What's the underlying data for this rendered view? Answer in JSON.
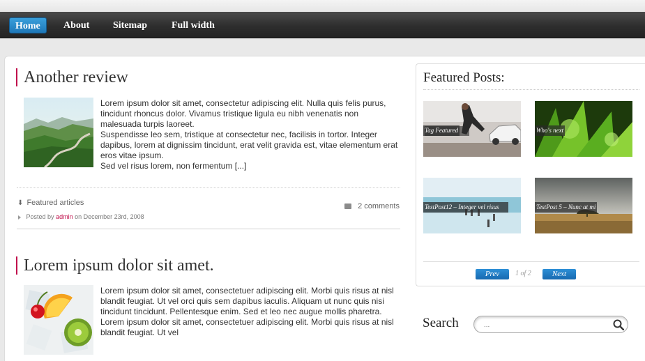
{
  "nav": {
    "items": [
      {
        "label": "Home",
        "active": true
      },
      {
        "label": "About",
        "active": false
      },
      {
        "label": "Sitemap",
        "active": false
      },
      {
        "label": "Full width",
        "active": false
      }
    ]
  },
  "posts": [
    {
      "title": "Another review",
      "paragraphs": [
        "Lorem ipsum dolor sit amet, consectetur adipiscing elit. Nulla quis felis purus, tincidunt rhoncus dolor. Vivamus tristique ligula eu nibh venenatis non malesuada turpis laoreet.",
        "Suspendisse leo sem, tristique at consectetur nec, facilisis in tortor. Integer dapibus, lorem at dignissim tincidunt, erat velit gravida est, vitae elementum erat eros vitae ipsum.",
        "Sed vel risus lorem, non fermentum [...]"
      ],
      "category": "Featured articles",
      "posted_by_prefix": "Posted by",
      "author": "admin",
      "date_text": "on December 23rd, 2008",
      "comments": "2 comments"
    },
    {
      "title": "Lorem ipsum dolor sit amet.",
      "paragraphs": [
        "Lorem ipsum dolor sit amet, consectetuer adipiscing elit. Morbi quis risus at nisl blandit feugiat. Ut vel orci quis sem dapibus iaculis. Aliquam ut nunc quis nisi tincidunt tincidunt. Pellentesque enim. Sed et leo nec augue mollis pharetra. Lorem ipsum dolor sit amet, consectetuer adipiscing elit. Morbi quis risus at nisl blandit feugiat. Ut vel"
      ]
    }
  ],
  "sidebar": {
    "featured": {
      "title": "Featured Posts:",
      "items": [
        {
          "caption": "Tag Featured"
        },
        {
          "caption": "Who's next"
        },
        {
          "caption": "TestPost12 – Integer vel risus"
        },
        {
          "caption": "TestPost 5 – Nunc at mi"
        }
      ],
      "prev": "Prev",
      "count": "1 of 2",
      "next": "Next"
    },
    "search": {
      "title": "Search",
      "placeholder": "..."
    }
  },
  "colors": {
    "accent": "#c00f4b",
    "nav_active": "#2a8ccd",
    "pager": "#1f78c1"
  }
}
